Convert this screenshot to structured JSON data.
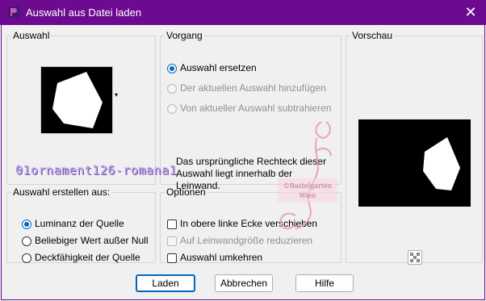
{
  "window": {
    "title": "Auswahl aus Datei laden",
    "close_glyph": "✕"
  },
  "auswahl_group": {
    "legend": "Auswahl",
    "dropdown_glyph": "▾"
  },
  "vorgang_group": {
    "legend": "Vorgang",
    "options": [
      {
        "label": "Auswahl ersetzen",
        "checked": true,
        "enabled": true
      },
      {
        "label": "Der aktuellen Auswahl hinzufügen",
        "checked": false,
        "enabled": false
      },
      {
        "label": "Von aktueller Auswahl subtrahieren",
        "checked": false,
        "enabled": false
      }
    ],
    "info_text": "Das ursprüngliche Rechteck dieser Auswahl liegt innerhalb der Leinwand."
  },
  "vorschau_group": {
    "legend": "Vorschau"
  },
  "erstellen_group": {
    "legend": "Auswahl erstellen aus:",
    "options": [
      {
        "label": "Luminanz der Quelle",
        "checked": true
      },
      {
        "label": "Beliebiger Wert außer Null",
        "checked": false
      },
      {
        "label": "Deckfähigkeit der Quelle",
        "checked": false
      }
    ]
  },
  "optionen_group": {
    "legend": "Optionen",
    "checks": [
      {
        "label": "In obere linke Ecke verschieben",
        "checked": false,
        "enabled": true
      },
      {
        "label": "Auf Leinwandgröße reduzieren",
        "checked": false,
        "enabled": false
      },
      {
        "label": "Auswahl umkehren",
        "checked": false,
        "enabled": true
      }
    ]
  },
  "buttons": {
    "ok": "Laden",
    "cancel": "Abbrechen",
    "help": "Hilfe"
  },
  "watermark": {
    "filename": "01ornament126-romana1",
    "stamp_line1": "©Bastelgarten",
    "stamp_line2": "Wien"
  },
  "colors": {
    "titlebar": "#6c0b8f",
    "accent": "#0067c0"
  }
}
